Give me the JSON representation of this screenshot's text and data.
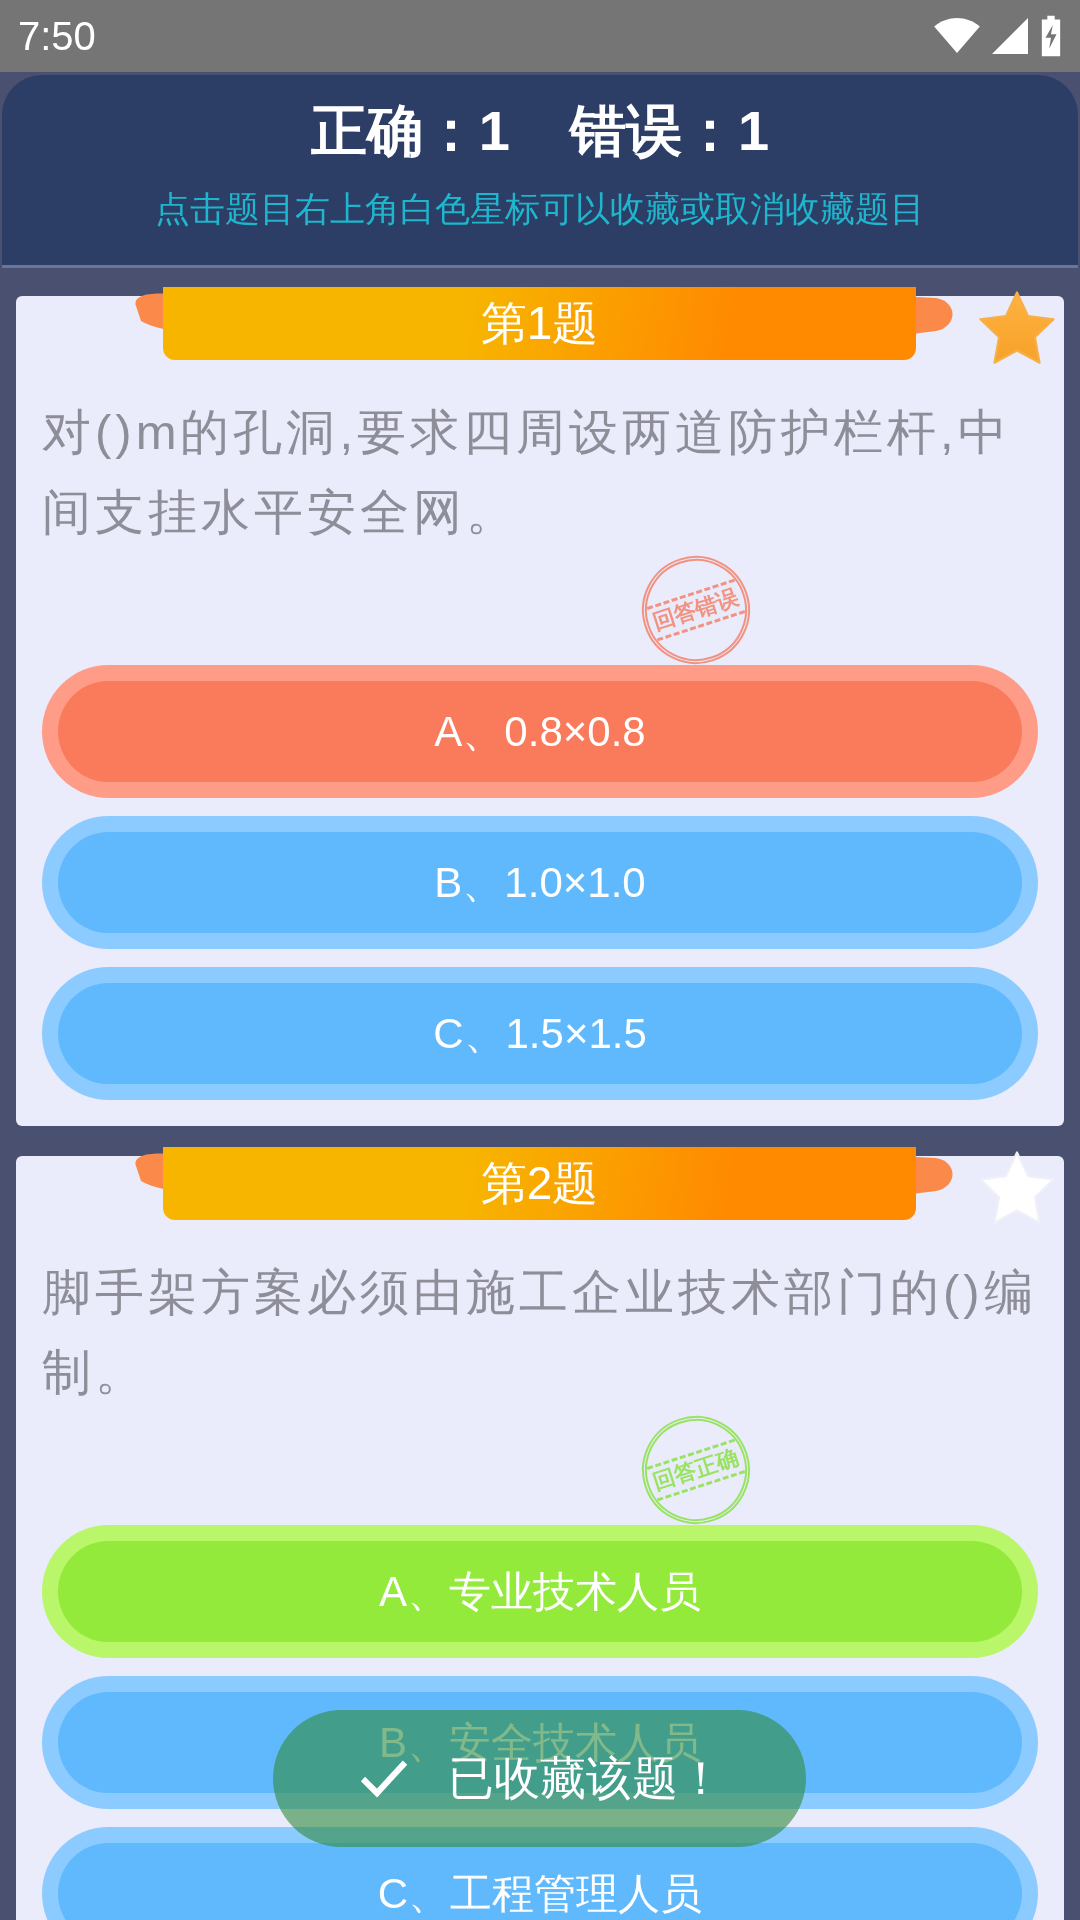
{
  "status_bar": {
    "time": "7:50"
  },
  "header": {
    "scores": [
      "正确：1",
      "错误：1"
    ],
    "hint": "点击题目右上角白色星标可以收藏或取消收藏题目"
  },
  "questions": [
    {
      "title": "第1题",
      "starred": true,
      "text": "对()m的孔洞,要求四周设两道防护栏杆,中间支挂水平安全网。",
      "stamp": {
        "text": "回答错误",
        "correct": false
      },
      "options": [
        {
          "label": "A、0.8×0.8",
          "selected": true,
          "correct": false
        },
        {
          "label": "B、1.0×1.0",
          "selected": false
        },
        {
          "label": "C、1.5×1.5",
          "selected": false
        }
      ]
    },
    {
      "title": "第2题",
      "starred": false,
      "text": "脚手架方案必须由施工企业技术部门的()编制。",
      "stamp": {
        "text": "回答正确",
        "correct": true
      },
      "options": [
        {
          "label": "A、专业技术人员",
          "selected": true,
          "correct": true
        },
        {
          "label": "B、安全技术人员",
          "selected": false
        },
        {
          "label": "C、工程管理人员",
          "selected": false
        }
      ]
    }
  ],
  "toast": {
    "text": "已收藏该题！"
  }
}
